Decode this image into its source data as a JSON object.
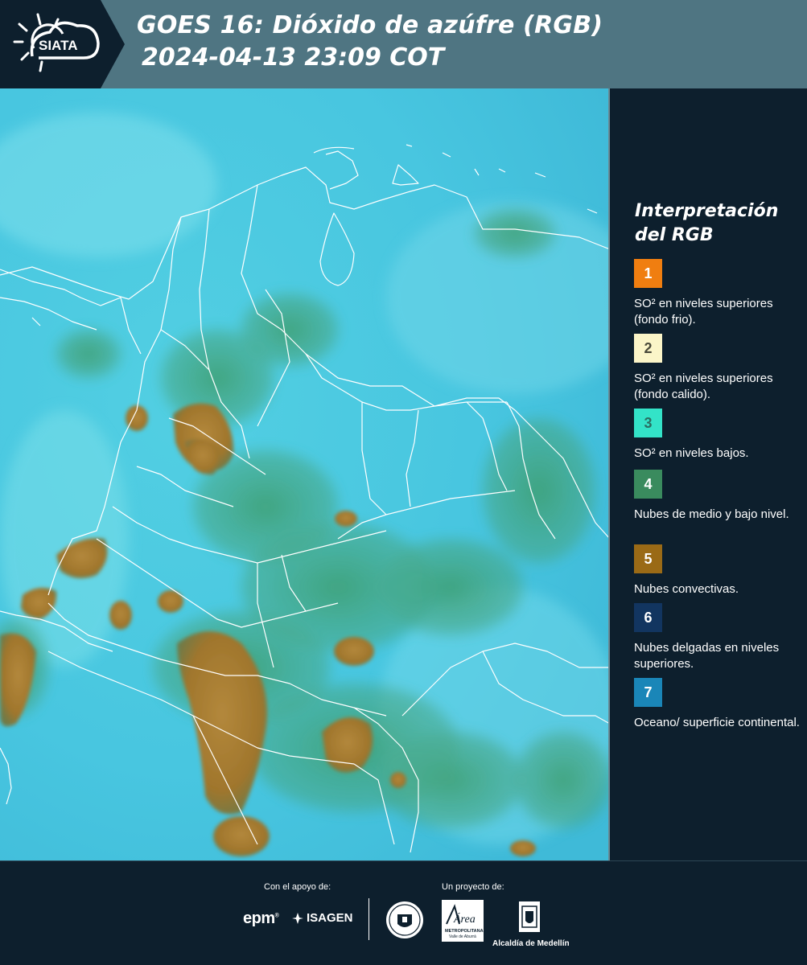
{
  "header": {
    "logo_text": "SIATA",
    "title_line1": "GOES 16: Dióxido de azúfre (RGB)",
    "title_line2": "2024-04-13 23:09 COT"
  },
  "legend": {
    "title": "Interpretación del RGB",
    "items": [
      {
        "number": "1",
        "color": "#f07e10",
        "text": "SO² en niveles superiores (fondo frio)."
      },
      {
        "number": "2",
        "color": "#fbf5c8",
        "text": "SO² en niveles superiores (fondo calido)."
      },
      {
        "number": "3",
        "color": "#33e3c8",
        "text": "SO² en niveles bajos."
      },
      {
        "number": "4",
        "color": "#3a8b5e",
        "text": "Nubes de medio y bajo nivel."
      },
      {
        "number": "5",
        "color": "#9a6a16",
        "text": "Nubes convectivas."
      },
      {
        "number": "6",
        "color": "#123560",
        "text": "Nubes delgadas en niveles superiores."
      },
      {
        "number": "7",
        "color": "#1a86b8",
        "text": "Oceano/ superficie continental."
      }
    ]
  },
  "footer": {
    "support_label": "Con el apoyo de:",
    "project_label": "Un proyecto de:",
    "epm_text": "epm",
    "isagen_text": "ISAGEN",
    "area_text": "Área",
    "area_sub1": "METROPOLITANA",
    "area_sub2": "Valle de Aburrá",
    "alcaldia_text": "Alcaldía de Medellín"
  },
  "colors": {
    "header_bg": "#4f7582",
    "panel_bg": "#0d1f2d",
    "map_base": "#4ecde3",
    "convective": "#a77a2a",
    "midlow": "#3d9a6a"
  }
}
